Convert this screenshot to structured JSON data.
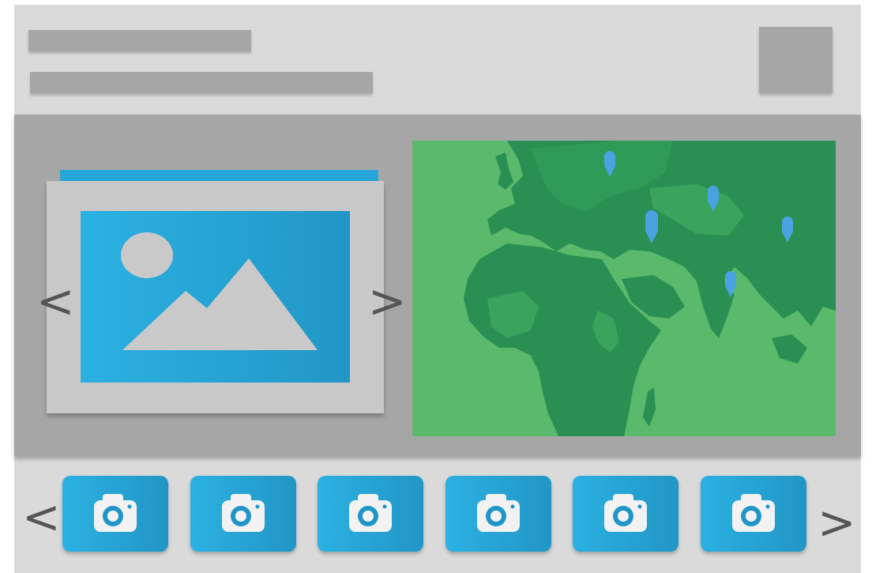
{
  "header": {
    "placeholder_bars": [
      "title-placeholder",
      "subtitle-placeholder"
    ],
    "avatar_icon": "avatar-placeholder"
  },
  "slideshow": {
    "prev_label": "<",
    "next_label": ">",
    "image_icon": "image-icon",
    "accent_color": "#27a6d8"
  },
  "map": {
    "icon": "world-map",
    "land_dark": "#2a8f52",
    "land_light": "#3aa45d",
    "marker_color": "#4aa3e0",
    "markers": [
      "pin",
      "pin",
      "pin",
      "pin",
      "pin"
    ]
  },
  "thumbnails": {
    "prev_label": "<",
    "next_label": ">",
    "icon": "camera-icon",
    "items": [
      {
        "icon": "camera-icon"
      },
      {
        "icon": "camera-icon"
      },
      {
        "icon": "camera-icon"
      },
      {
        "icon": "camera-icon"
      },
      {
        "icon": "camera-icon"
      },
      {
        "icon": "camera-icon"
      }
    ]
  }
}
